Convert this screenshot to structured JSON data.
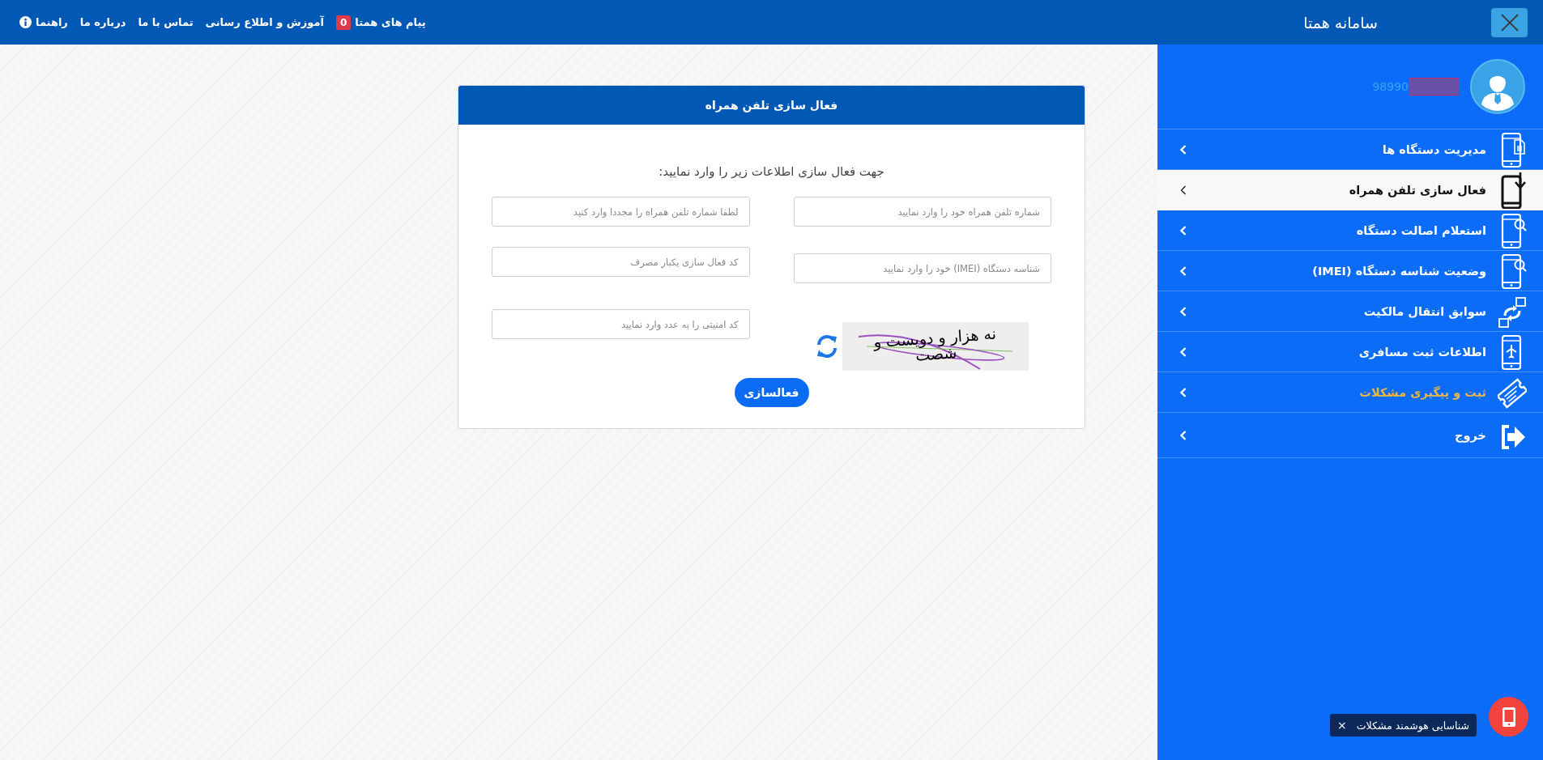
{
  "header": {
    "title": "سامانه همتا",
    "nav": [
      {
        "label": "پیام های همتا",
        "kind": "badge",
        "badge": "0"
      },
      {
        "label": "آموزش و اطلاع رسانی",
        "kind": "link"
      },
      {
        "label": "تماس با ما",
        "kind": "link"
      },
      {
        "label": "درباره ما",
        "kind": "link"
      },
      {
        "label": "راهنما",
        "kind": "info"
      }
    ]
  },
  "sidebar": {
    "user": {
      "phone": "98990",
      "redacted": true
    },
    "items": [
      {
        "label": "مدیریت دستگاه ها",
        "kind": "devices",
        "selected": false,
        "highlighted": false
      },
      {
        "label": "فعال سازی تلفن همراه",
        "kind": "activation",
        "selected": true,
        "highlighted": false
      },
      {
        "label": "استعلام اصالت دستگاه",
        "kind": "inquiry",
        "selected": false,
        "highlighted": false
      },
      {
        "label": "وضعیت شناسه دستگاه (IMEI)",
        "kind": "inquiry",
        "selected": false,
        "highlighted": false
      },
      {
        "label": "سوابق انتقال مالکیت",
        "kind": "transfer",
        "selected": false,
        "highlighted": false
      },
      {
        "label": "اطلاعات ثبت مسافری",
        "kind": "travel",
        "selected": false,
        "highlighted": false
      },
      {
        "label": "ثبت و پیگیری مشکلات",
        "kind": "ticket",
        "selected": false,
        "highlighted": true
      },
      {
        "label": "خروج",
        "kind": "logout",
        "selected": false,
        "highlighted": false
      }
    ]
  },
  "form": {
    "title": "فعال سازی تلفن همراه",
    "instruction": "جهت فعال سازی اطلاعات زیر را وارد نمایید:",
    "columns": [
      {
        "fields": [
          {
            "placeholder": "شماره تلفن همراه خود را وارد نمایید"
          },
          {
            "placeholder": "شناسه دستگاه (IMEI) خود را وارد نمایید"
          }
        ],
        "captcha": {
          "text": "نه هزار و دویست و شصت"
        }
      },
      {
        "fields": [
          {
            "placeholder": "لطفا شماره تلفن همراه را مجددا وارد کنید"
          },
          {
            "placeholder": "کد فعال سازی یکبار مصرف"
          },
          {
            "placeholder": "کد امنیتی را به عدد وارد نمایید"
          }
        ]
      }
    ],
    "submit": "فعالسازی"
  },
  "assistant": {
    "tooltip": "شناسایی هوشمند مشکلات",
    "close": "×"
  }
}
